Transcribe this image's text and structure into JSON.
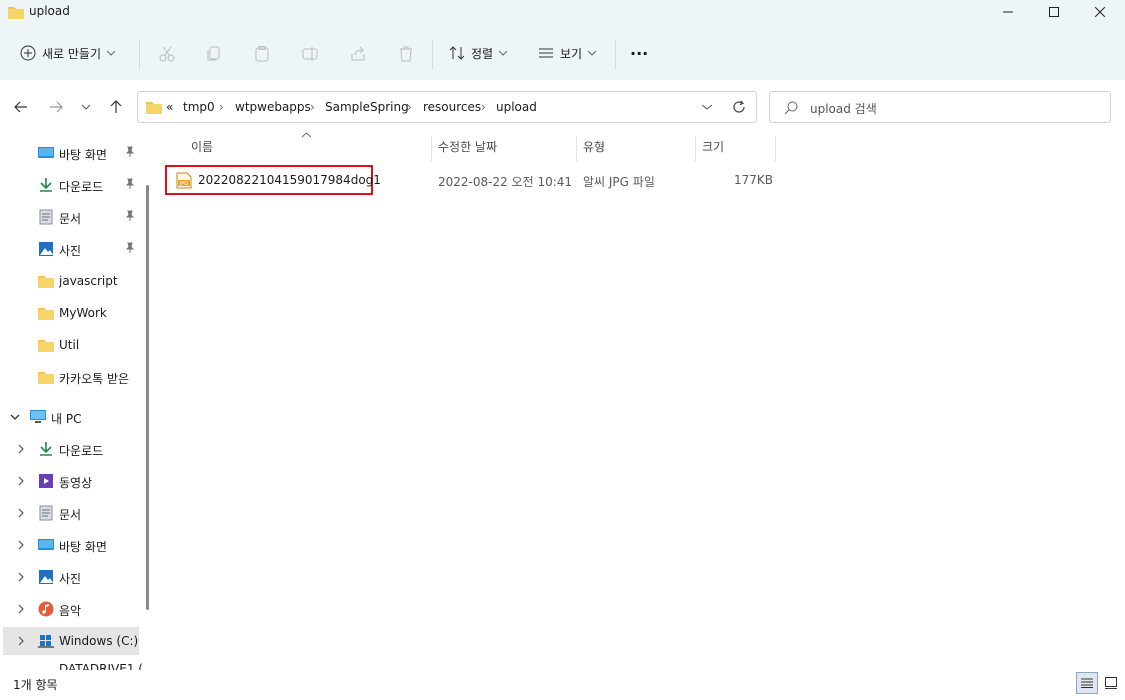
{
  "window": {
    "title": "upload"
  },
  "toolbar": {
    "new_label": "새로 만들기",
    "sort_label": "정렬",
    "view_label": "보기",
    "more_label": "···"
  },
  "address": {
    "overflow": "«",
    "crumbs": [
      "tmp0",
      "wtpwebapps",
      "SampleSpring",
      "resources",
      "upload"
    ]
  },
  "search": {
    "placeholder": "upload 검색"
  },
  "sidebar": {
    "quick": [
      {
        "label": "바탕 화면",
        "icon": "desktop-icon",
        "pinned": true
      },
      {
        "label": "다운로드",
        "icon": "download-icon",
        "pinned": true
      },
      {
        "label": "문서",
        "icon": "document-icon",
        "pinned": true
      },
      {
        "label": "사진",
        "icon": "picture-icon",
        "pinned": true
      },
      {
        "label": "javascript",
        "icon": "folder-icon",
        "pinned": false
      },
      {
        "label": "MyWork",
        "icon": "folder-icon",
        "pinned": false
      },
      {
        "label": "Util",
        "icon": "folder-icon",
        "pinned": false
      },
      {
        "label": "카카오톡 받은",
        "icon": "folder-icon",
        "pinned": false
      }
    ],
    "pc": {
      "label": "내 PC"
    },
    "pc_items": [
      {
        "label": "다운로드",
        "icon": "download-icon"
      },
      {
        "label": "동영상",
        "icon": "video-icon"
      },
      {
        "label": "문서",
        "icon": "document-icon"
      },
      {
        "label": "바탕 화면",
        "icon": "desktop-icon"
      },
      {
        "label": "사진",
        "icon": "picture-icon"
      },
      {
        "label": "음악",
        "icon": "music-icon"
      },
      {
        "label": "Windows  (C:)",
        "icon": "drive-icon"
      },
      {
        "label": "DATADRIVE1 (",
        "icon": "drive-icon"
      }
    ]
  },
  "columns": {
    "name": "이름",
    "modified": "수정한 날짜",
    "type": "유형",
    "size": "크기"
  },
  "files": [
    {
      "name": "20220822104159017984dog1",
      "modified": "2022-08-22 오전 10:41",
      "type": "알씨 JPG 파일",
      "size": "177KB"
    }
  ],
  "status": {
    "count": "1개 항목"
  },
  "colors": {
    "chrome": "#eef5f9",
    "highlight": "#e0101a",
    "folder": "#f2c346",
    "accent": "#0a5bc4"
  }
}
